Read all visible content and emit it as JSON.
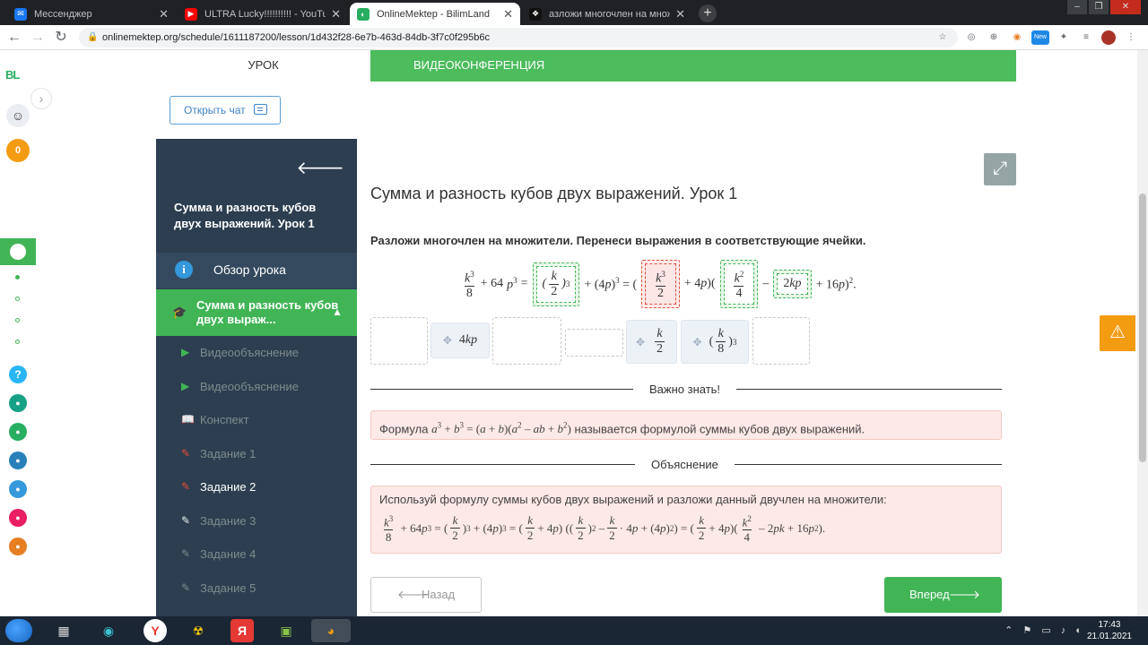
{
  "browser": {
    "tabs": [
      {
        "title": "Мессенджер",
        "icon": "messenger-icon",
        "active": false
      },
      {
        "title": "ULTRA Lucky!!!!!!!!!! - YouTube",
        "icon": "youtube-icon",
        "active": false
      },
      {
        "title": "OnlineMektep - BilimLand",
        "icon": "bilimland-icon",
        "active": true
      },
      {
        "title": "азложи многочлен на множите",
        "icon": "bookmark-icon",
        "active": false
      }
    ],
    "url": "onlinemektep.org/schedule/1611187200/lesson/1d432f28-6e7b-463d-84db-3f7c0f295b6c",
    "new_badge": "New"
  },
  "rail": {
    "logo": "BL",
    "coins": "0",
    "help": "?"
  },
  "top_tabs": {
    "lesson": "УРОК",
    "video": "ВИДЕОКОНФЕРЕНЦИЯ"
  },
  "chat_button": "Открыть чат",
  "sidebar": {
    "title": "Сумма и разность кубов двух выражений. Урок 1",
    "overview": "Обзор урока",
    "section": "Сумма и разность кубов двух выраж...",
    "items": [
      {
        "label": "Видеообъяснение",
        "icon": "play-icon",
        "state": "green"
      },
      {
        "label": "Видеообъяснение",
        "icon": "play-icon",
        "state": "green"
      },
      {
        "label": "Конспект",
        "icon": "book-icon",
        "state": "green"
      },
      {
        "label": "Задание 1",
        "icon": "edit-icon",
        "state": "red"
      },
      {
        "label": "Задание 2",
        "icon": "edit-icon",
        "state": "current"
      },
      {
        "label": "Задание 3",
        "icon": "edit-icon",
        "state": "gray"
      },
      {
        "label": "Задание 4",
        "icon": "edit-icon",
        "state": "gray"
      },
      {
        "label": "Задание 5",
        "icon": "edit-icon",
        "state": "gray"
      }
    ]
  },
  "main": {
    "heading": "Сумма и разность кубов двух выражений. Урок 1",
    "task": "Разложи многочлен на множители. Перенеси выражения в соответствующие ячейки.",
    "equation": {
      "lhs_plus": "+ 64",
      "p": "p",
      "eq1": "=",
      "paren_plus": "+ (4p)",
      "eq2": "= (",
      "plus_4p": "+ 4p)(",
      "minus": "–",
      "tail": "+ 16p)"
    },
    "bank": {
      "chip_4kp": "4kp",
      "chip_k2": "k",
      "chip_k8": "k"
    },
    "important_label": "Важно знать!",
    "formula_prefix": "Формула",
    "formula_suffix": "называется формулой суммы кубов двух выражений.",
    "explain_label": "Объяснение",
    "explain_text": "Используй формулу суммы кубов двух выражений и разложи данный двучлен на множители:",
    "back_button": "Назад",
    "next_button": "Вперед"
  },
  "taskbar": {
    "time": "17:43",
    "date": "21.01.2021"
  },
  "colors": {
    "green": "#41b556",
    "sidebar": "#2c3e50",
    "orange": "#f39c12",
    "error_bg": "#fde9e7"
  }
}
